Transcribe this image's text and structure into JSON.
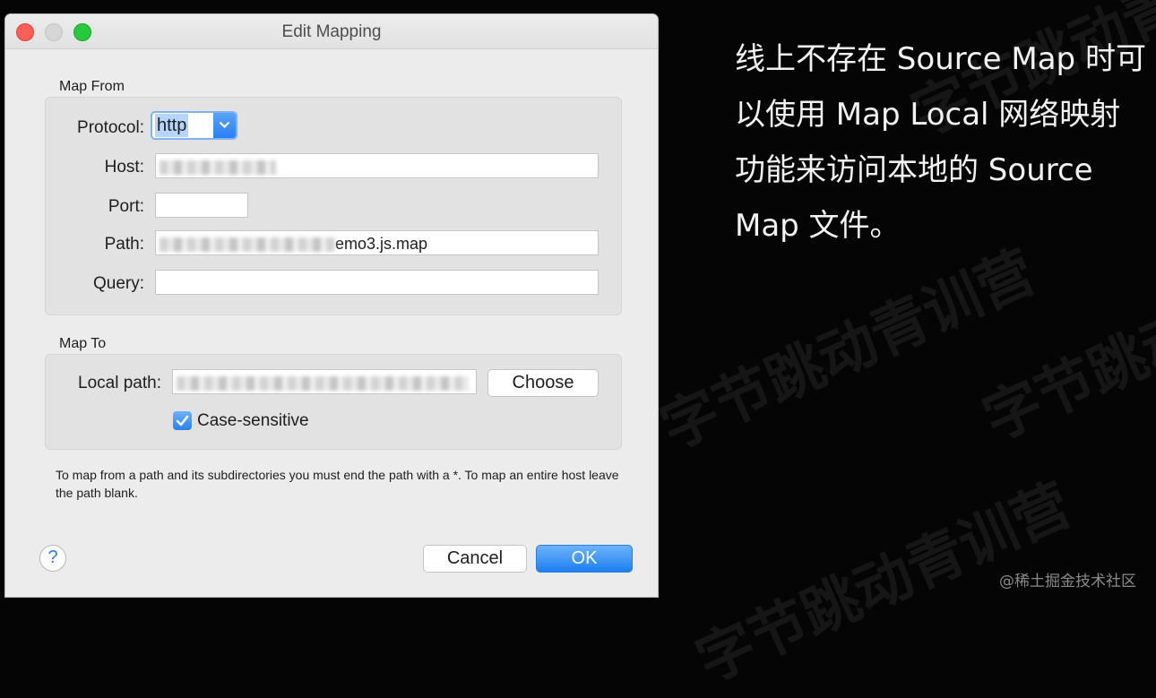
{
  "window": {
    "title": "Edit Mapping",
    "accent": "#2a7ff2"
  },
  "map_from": {
    "label": "Map From",
    "protocol": {
      "label": "Protocol:",
      "value": "http"
    },
    "host": {
      "label": "Host:",
      "value": ""
    },
    "port": {
      "label": "Port:",
      "value": ""
    },
    "path": {
      "label": "Path:",
      "value_visible_suffix": "emo3.js.map"
    },
    "query": {
      "label": "Query:",
      "value": ""
    }
  },
  "map_to": {
    "label": "Map To",
    "local_path": {
      "label": "Local path:",
      "value": ""
    },
    "choose_label": "Choose",
    "case_sensitive": {
      "label": "Case-sensitive",
      "checked": true
    }
  },
  "note": "To map from a path and its subdirectories you must end the path with a *. To map an entire host leave the path blank.",
  "buttons": {
    "help": "?",
    "cancel": "Cancel",
    "ok": "OK"
  },
  "side_text": "线上不存在 Source Map 时可以使用 Map Local 网络映射功能来访问本地的 Source Map 文件。",
  "watermark": "字节跳动青训营",
  "credit": "@稀土掘金技术社区"
}
